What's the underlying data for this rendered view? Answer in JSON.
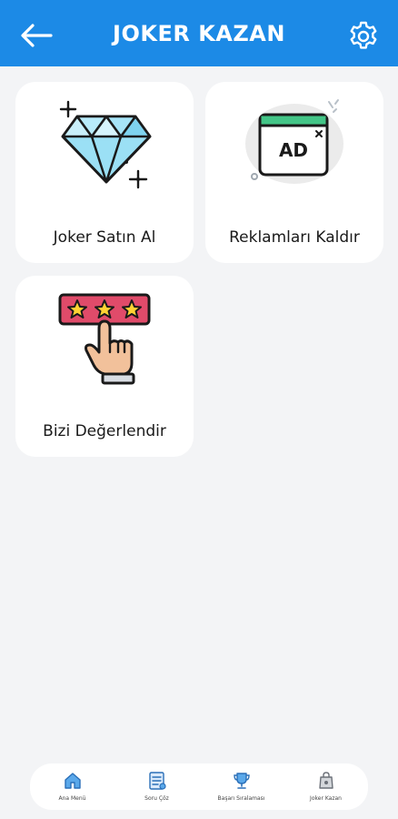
{
  "header": {
    "title": "JOKER KAZAN",
    "back_icon": "arrow-left-icon",
    "settings_icon": "gear-icon",
    "background": "#1c8ae6"
  },
  "cards": [
    {
      "label": "Joker Satın Al",
      "icon": "diamond-icon"
    },
    {
      "label": "Reklamları Kaldır",
      "icon": "ad-block-icon"
    },
    {
      "label": "Bizi Değerlendir",
      "icon": "rating-stars-icon"
    }
  ],
  "bottom_nav": {
    "items": [
      {
        "label": "Ana Menü",
        "icon": "home-icon"
      },
      {
        "label": "Soru Çöz",
        "icon": "quiz-icon"
      },
      {
        "label": "Başarı Sıralaması",
        "icon": "trophy-icon"
      },
      {
        "label": "Joker Kazan",
        "icon": "bag-icon"
      }
    ]
  }
}
